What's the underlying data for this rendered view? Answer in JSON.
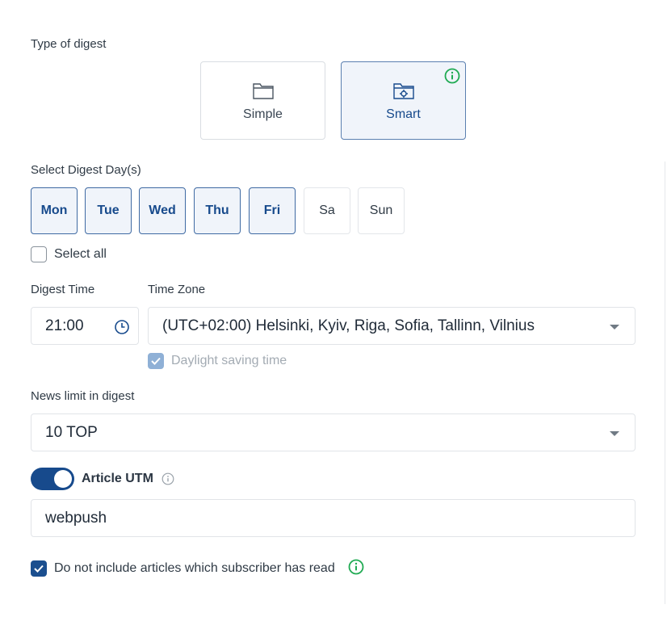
{
  "digest_type": {
    "label": "Type of digest",
    "options": [
      {
        "label": "Simple",
        "icon": "folder-icon",
        "selected": false
      },
      {
        "label": "Smart",
        "icon": "folder-gear-icon",
        "selected": true
      }
    ],
    "info_icon": "info-icon"
  },
  "days": {
    "label": "Select Digest Day(s)",
    "items": [
      {
        "label": "Mon",
        "active": true
      },
      {
        "label": "Tue",
        "active": true
      },
      {
        "label": "Wed",
        "active": true
      },
      {
        "label": "Thu",
        "active": true
      },
      {
        "label": "Fri",
        "active": true
      },
      {
        "label": "Sa",
        "active": false
      },
      {
        "label": "Sun",
        "active": false
      }
    ],
    "select_all_label": "Select all",
    "select_all_checked": false
  },
  "time": {
    "label": "Digest Time",
    "value": "21:00",
    "icon": "clock-icon"
  },
  "timezone": {
    "label": "Time Zone",
    "value": "(UTC+02:00) Helsinki, Kyiv, Riga, Sofia, Tallinn, Vilnius",
    "dst_label": "Daylight saving time",
    "dst_checked": true
  },
  "news_limit": {
    "label": "News limit in digest",
    "value": "10 TOP"
  },
  "utm": {
    "toggle_on": true,
    "label": "Article UTM",
    "value": "webpush"
  },
  "exclude_read": {
    "label": "Do not include articles which subscriber has read",
    "checked": true
  },
  "colors": {
    "primary": "#174a8c",
    "selected_bg": "#f0f4fa",
    "info_green": "#1faa52"
  }
}
